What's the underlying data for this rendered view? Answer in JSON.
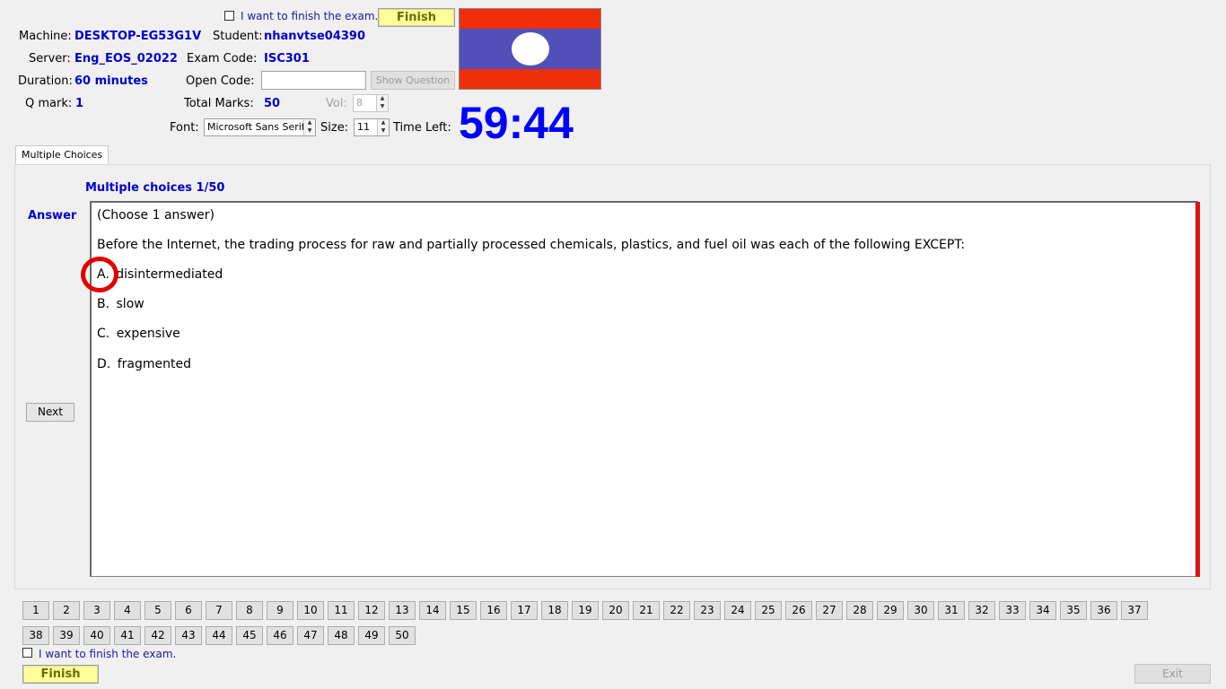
{
  "header": {
    "finish_check_label": "I want to finish the exam.",
    "finish_button": "Finish",
    "machine_label": "Machine:",
    "machine_value": "DESKTOP-EG53G1V",
    "student_label": "Student:",
    "student_value": "nhanvtse04390",
    "server_label": "Server:",
    "server_value": "Eng_EOS_02022",
    "exam_code_label": "Exam Code:",
    "exam_code_value": "ISC301",
    "duration_label": "Duration:",
    "duration_value": "60 minutes",
    "open_code_label": "Open Code:",
    "open_code_value": "",
    "show_question_button": "Show Question",
    "qmark_label": "Q mark:",
    "qmark_value": "1",
    "total_marks_label": "Total Marks:",
    "total_marks_value": "50",
    "vol_label": "Vol:",
    "vol_value": "8",
    "font_label": "Font:",
    "font_value": "Microsoft Sans Serif",
    "size_label": "Size:",
    "size_value": "11",
    "time_left_label": "Time Left:",
    "timer_value": "59:44"
  },
  "tabs": [
    {
      "label": "Multiple Choices"
    }
  ],
  "question": {
    "heading": "Multiple choices 1/50",
    "answer_label": "Answer",
    "next_button": "Next",
    "instruction": "(Choose 1 answer)",
    "text": "Before the Internet, the trading process for raw and partially processed chemicals, plastics, and fuel oil was each of the following EXCEPT:",
    "options": [
      {
        "letter": "A.",
        "text": "disintermediated"
      },
      {
        "letter": "B.",
        "text": "slow"
      },
      {
        "letter": "C.",
        "text": "expensive"
      },
      {
        "letter": "D.",
        "text": "fragmented"
      }
    ]
  },
  "navigation": {
    "row1": [
      "1",
      "2",
      "3",
      "4",
      "5",
      "6",
      "7",
      "8",
      "9",
      "10",
      "11",
      "12",
      "13",
      "14",
      "15",
      "16",
      "17",
      "18",
      "19",
      "20",
      "21",
      "22",
      "23",
      "24",
      "25",
      "26",
      "27",
      "28",
      "29",
      "30",
      "31",
      "32",
      "33",
      "34",
      "35",
      "36",
      "37"
    ],
    "row2": [
      "38",
      "39",
      "40",
      "41",
      "42",
      "43",
      "44",
      "45",
      "46",
      "47",
      "48",
      "49",
      "50"
    ]
  },
  "footer": {
    "finish_check_label": "I want to finish the exam.",
    "finish_button": "Finish",
    "exit_button": "Exit"
  },
  "colors": {
    "accent_blue": "#0000cc",
    "timer_blue": "#0000ff",
    "finish_yellow": "#ffff99",
    "flag_red": "#f02e0a",
    "flag_blue": "#5050b8",
    "marker_red": "#e00000"
  }
}
